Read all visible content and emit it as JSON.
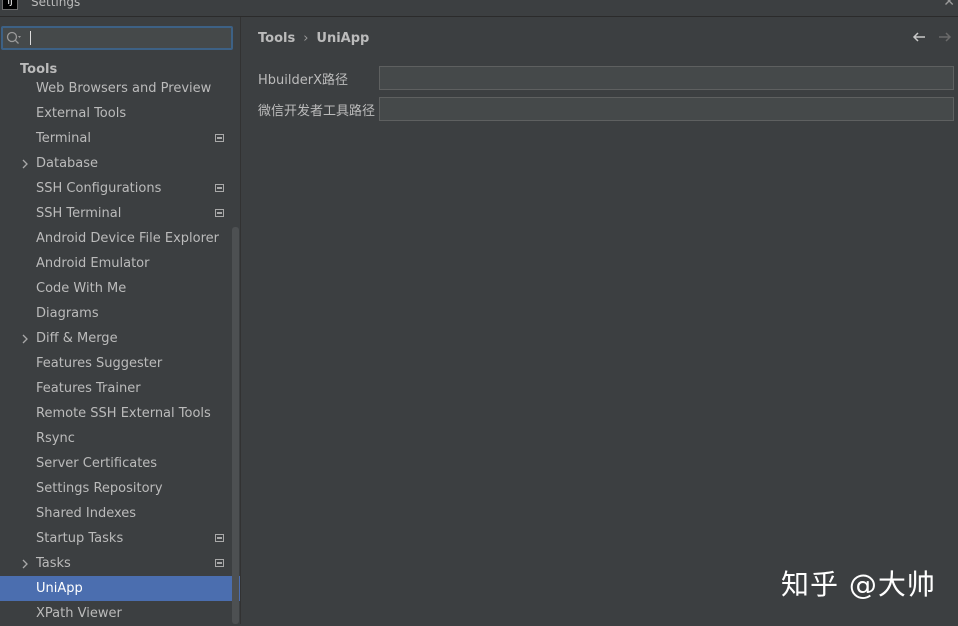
{
  "window": {
    "title": "Settings"
  },
  "search": {
    "value": "",
    "placeholder": ""
  },
  "sidebar": {
    "section": "Tools",
    "items": [
      {
        "label": "Web Browsers and Preview"
      },
      {
        "label": "External Tools"
      },
      {
        "label": "Terminal"
      },
      {
        "label": "Database"
      },
      {
        "label": "SSH Configurations"
      },
      {
        "label": "SSH Terminal"
      },
      {
        "label": "Android Device File Explorer"
      },
      {
        "label": "Android Emulator"
      },
      {
        "label": "Code With Me"
      },
      {
        "label": "Diagrams"
      },
      {
        "label": "Diff & Merge"
      },
      {
        "label": "Features Suggester"
      },
      {
        "label": "Features Trainer"
      },
      {
        "label": "Remote SSH External Tools"
      },
      {
        "label": "Rsync"
      },
      {
        "label": "Server Certificates"
      },
      {
        "label": "Settings Repository"
      },
      {
        "label": "Shared Indexes"
      },
      {
        "label": "Startup Tasks"
      },
      {
        "label": "Tasks"
      },
      {
        "label": "UniApp"
      },
      {
        "label": "XPath Viewer"
      }
    ]
  },
  "breadcrumb": {
    "parent": "Tools",
    "separator": "›",
    "current": "UniApp"
  },
  "fields": [
    {
      "label": "HbuilderX路径",
      "value": ""
    },
    {
      "label": "微信开发者工具路径",
      "value": ""
    }
  ],
  "watermark": {
    "text": "知乎 @大帅"
  },
  "colors": {
    "background": "#3c3f41",
    "selection": "#4b6eaf",
    "search_focus": "#3d6185"
  }
}
